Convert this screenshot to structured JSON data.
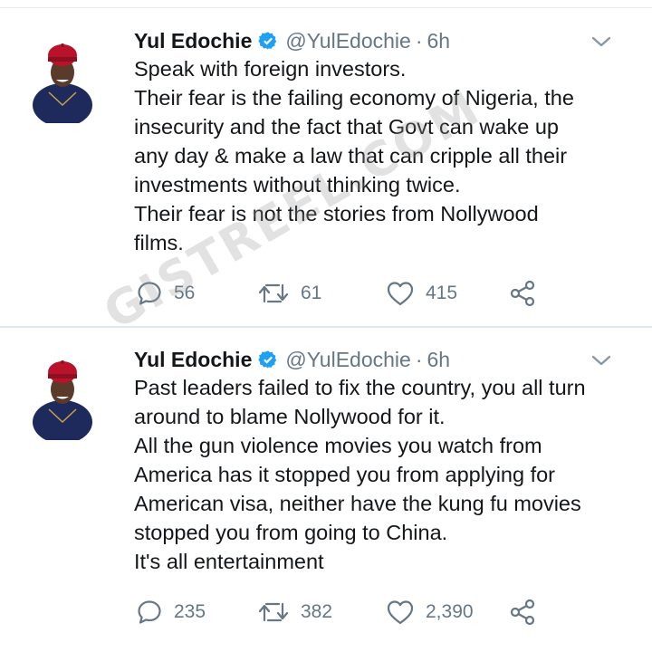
{
  "tweets": [
    {
      "name": "Yul Edochie",
      "handle": "@YulEdochie",
      "separator": "·",
      "time": "6h",
      "text_lines": [
        "Speak with foreign investors.",
        "Their fear is the failing economy of Nigeria, the",
        "insecurity and the fact that Govt can wake up",
        "any day & make a law that can cripple all their",
        "investments without thinking twice.",
        "Their fear is not the stories from Nollywood",
        "films."
      ],
      "replies": "56",
      "retweets": "61",
      "likes": "415"
    },
    {
      "name": "Yul Edochie",
      "handle": "@YulEdochie",
      "separator": "·",
      "time": "6h",
      "text_lines": [
        "Past leaders failed to fix the country, you all turn",
        "around to blame Nollywood for it.",
        "All the gun violence movies you watch from",
        "America has it stopped you from applying for",
        "American visa, neither have the kung fu movies",
        "stopped you from going to China.",
        "It's all entertainment"
      ],
      "replies": "235",
      "retweets": "382",
      "likes": "2,390"
    }
  ],
  "watermark": "GISTREEL.COM",
  "icons": {
    "verified": "verified-badge-icon",
    "caret": "chevron-down-icon",
    "reply": "reply-icon",
    "retweet": "retweet-icon",
    "like": "heart-icon",
    "share": "share-icon"
  },
  "colors": {
    "text": "#14171a",
    "muted": "#657786",
    "verified": "#1da1f2",
    "divider": "#e1e8ed"
  }
}
